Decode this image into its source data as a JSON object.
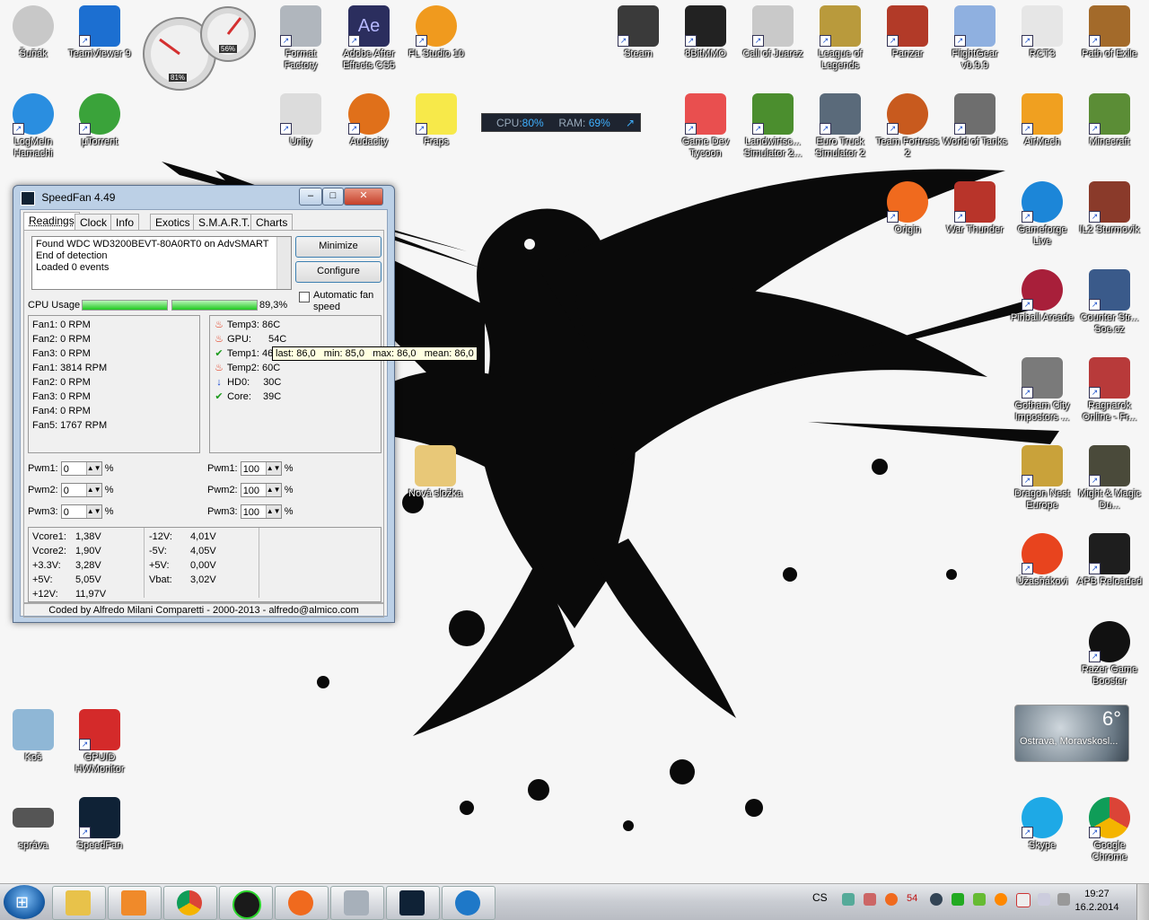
{
  "desktop": {
    "icons_left": [
      {
        "label": "Šuňák",
        "icon": "disk-icon",
        "color": "#c8c8c8"
      },
      {
        "label": "TeamViewer 9",
        "icon": "teamviewer-icon",
        "color": "#1c6fd1"
      },
      {
        "label": "Format Factory",
        "icon": "format-factory-icon",
        "color": "#b0b6bd"
      },
      {
        "label": "Adobe After Effects CS5",
        "icon": "after-effects-icon",
        "color": "#2b2e5e"
      },
      {
        "label": "FL Studio 10",
        "icon": "fl-studio-icon",
        "color": "#f09a1e"
      },
      {
        "label": "LogMeIn Hamachi",
        "icon": "hamachi-icon",
        "color": "#2a8ee0"
      },
      {
        "label": "µTorrent",
        "icon": "utorrent-icon",
        "color": "#3aa33a"
      },
      {
        "label": "Unity",
        "icon": "unity-icon",
        "color": "#dcdcdc"
      },
      {
        "label": "Audacity",
        "icon": "audacity-icon",
        "color": "#e0701a"
      },
      {
        "label": "Fraps",
        "icon": "fraps-icon",
        "color": "#f7e94a"
      },
      {
        "label": "Koš",
        "icon": "recycle-bin-icon",
        "color": "#8fb7d6"
      },
      {
        "label": "GPUID HWMonitor",
        "icon": "hwmonitor-icon",
        "color": "#d42a2a"
      },
      {
        "label": "správa",
        "icon": "chip-icon",
        "color": "#555555"
      },
      {
        "label": "SpeedFan",
        "icon": "speedfan-icon",
        "color": "#0f2236"
      }
    ],
    "icons_right": [
      {
        "label": "Steam",
        "icon": "steam-icon",
        "color": "#3a3a3a"
      },
      {
        "label": "8BitMMO",
        "icon": "8bitmmo-icon",
        "color": "#222222"
      },
      {
        "label": "Call of Juarez",
        "icon": "call-of-juarez-icon",
        "color": "#c9c9c9"
      },
      {
        "label": "League of Legends",
        "icon": "lol-icon",
        "color": "#b99a3c"
      },
      {
        "label": "Panzar",
        "icon": "panzar-icon",
        "color": "#b23a28"
      },
      {
        "label": "FlightGear v0.9.9",
        "icon": "flightgear-icon",
        "color": "#8fb0e0"
      },
      {
        "label": "RCT3",
        "icon": "rct3-icon",
        "color": "#e6e6e6"
      },
      {
        "label": "Path of Exile",
        "icon": "poe-icon",
        "color": "#a36a2a"
      },
      {
        "label": "Game Dev Tycoon",
        "icon": "game-dev-tycoon-icon",
        "color": "#e94f4f"
      },
      {
        "label": "Landwirtsc... Simulator 2...",
        "icon": "farming-sim-icon",
        "color": "#4b8e2e"
      },
      {
        "label": "Euro Truck Simulator 2",
        "icon": "ets2-icon",
        "color": "#5a6a7a"
      },
      {
        "label": "Team Fortress 2",
        "icon": "tf2-icon",
        "color": "#c85a1e"
      },
      {
        "label": "World of Tanks",
        "icon": "wot-icon",
        "color": "#6e6e6e"
      },
      {
        "label": "AirMech",
        "icon": "airmech-icon",
        "color": "#f0a020"
      },
      {
        "label": "Minecraft",
        "icon": "minecraft-icon",
        "color": "#5b8d36"
      },
      {
        "label": "Origin",
        "icon": "origin-icon",
        "color": "#f06a1e"
      },
      {
        "label": "War Thunder",
        "icon": "war-thunder-icon",
        "color": "#b8342a"
      },
      {
        "label": "Gameforge Live",
        "icon": "gameforge-icon",
        "color": "#1c86d8"
      },
      {
        "label": "IL2 Sturmovik",
        "icon": "il2-icon",
        "color": "#8a3a2a"
      },
      {
        "label": "Pinball Arcade",
        "icon": "pinball-icon",
        "color": "#a81f3a"
      },
      {
        "label": "Counter Str... Soe.cz",
        "icon": "counter-strike-icon",
        "color": "#3a5a8a"
      },
      {
        "label": "Gotham City Impostors ...",
        "icon": "gotham-icon",
        "color": "#7a7a7a"
      },
      {
        "label": "Ragnarok Online - Fr...",
        "icon": "ragnarok-icon",
        "color": "#b83a3a"
      },
      {
        "label": "Dragon Nest Europe",
        "icon": "dragon-nest-icon",
        "color": "#c9a23a"
      },
      {
        "label": "Might & Magic Du...",
        "icon": "might-magic-icon",
        "color": "#4a4a3a"
      },
      {
        "label": "Úžasňákovi",
        "icon": "incredibles-icon",
        "color": "#e8441e"
      },
      {
        "label": "APB Reloaded",
        "icon": "apb-icon",
        "color": "#1e1e1e"
      },
      {
        "label": "Razer Game Booster",
        "icon": "razer-icon",
        "color": "#111111"
      },
      {
        "label": "Skype",
        "icon": "skype-icon",
        "color": "#1ea9e6"
      },
      {
        "label": "Google Chrome",
        "icon": "chrome-icon",
        "color": "#e0b020"
      }
    ],
    "folder": {
      "label": "Nová složka",
      "icon": "folder-icon"
    }
  },
  "gauge_gadget": {
    "cpu": "81%",
    "ram": "56%"
  },
  "cpu_widget": {
    "cpu_label": "CPU:",
    "cpu_value": "80%",
    "ram_label": "RAM:",
    "ram_value": "69%"
  },
  "speedfan": {
    "title": "SpeedFan 4.49",
    "tabs": [
      "Readings",
      "Clock",
      "Info",
      "Exotics",
      "S.M.A.R.T.",
      "Charts"
    ],
    "log": [
      "Found WDC WD3200BEVT-80A0RT0 on AdvSMART",
      "End of detection",
      "Loaded 0 events"
    ],
    "buttons": {
      "minimize": "Minimize",
      "configure": "Configure"
    },
    "auto_fan": "Automatic fan speed",
    "cpu_usage_label": "CPU Usage",
    "cpu_usage_value": "89,3%",
    "cpu_usage_bars": [
      1.0,
      1.0
    ],
    "fans": [
      "Fan1: 0 RPM",
      "Fan2: 0 RPM",
      "Fan3: 0 RPM",
      "Fan1: 3814 RPM",
      "Fan2: 0 RPM",
      "Fan3: 0 RPM",
      "Fan4: 0 RPM",
      "Fan5: 1767 RPM"
    ],
    "temps": [
      {
        "label": "Temp3:",
        "value": "86C",
        "status": "hot"
      },
      {
        "label": "GPU:",
        "value": "54C",
        "status": "hot"
      },
      {
        "label": "Temp1:",
        "value": "46C",
        "status": "ok"
      },
      {
        "label": "Temp2:",
        "value": "60C",
        "status": "hot"
      },
      {
        "label": "HD0:",
        "value": "30C",
        "status": "down"
      },
      {
        "label": "Core:",
        "value": "39C",
        "status": "ok"
      }
    ],
    "tooltip": "last: 86,0   min: 85,0   max: 86,0   mean: 86,0",
    "pwm_left": [
      {
        "label": "Pwm1:",
        "value": "0"
      },
      {
        "label": "Pwm2:",
        "value": "0"
      },
      {
        "label": "Pwm3:",
        "value": "0"
      }
    ],
    "pwm_right": [
      {
        "label": "Pwm1:",
        "value": "100"
      },
      {
        "label": "Pwm2:",
        "value": "100"
      },
      {
        "label": "Pwm3:",
        "value": "100"
      }
    ],
    "pwm_unit": "%",
    "volts_a": [
      {
        "label": "Vcore1:",
        "value": "1,38V"
      },
      {
        "label": "Vcore2:",
        "value": "1,90V"
      },
      {
        "label": "+3.3V:",
        "value": "3,28V"
      },
      {
        "label": "+5V:",
        "value": "5,05V"
      },
      {
        "label": "+12V:",
        "value": "11,97V"
      }
    ],
    "volts_b": [
      {
        "label": "-12V:",
        "value": "4,01V"
      },
      {
        "label": "-5V:",
        "value": "4,05V"
      },
      {
        "label": "+5V:",
        "value": "0,00V"
      },
      {
        "label": "Vbat:",
        "value": "3,02V"
      }
    ],
    "footer": "Coded by Alfredo Milani Comparetti - 2000-2013 - alfredo@almico.com"
  },
  "weather": {
    "temp": "6°",
    "location": "Ostrava, Moravskosl..."
  },
  "taskbar": {
    "apps": [
      {
        "icon": "explorer-icon",
        "color": "#e8c24a"
      },
      {
        "icon": "media-player-icon",
        "color": "#f08a2a"
      },
      {
        "icon": "chrome-icon",
        "color": "#d9412f"
      },
      {
        "icon": "razer-icon",
        "color": "#1a1a1a"
      },
      {
        "icon": "origin-icon",
        "color": "#f06a1e"
      },
      {
        "icon": "format-factory-icon",
        "color": "#a7b0ba"
      },
      {
        "icon": "speedfan-icon",
        "color": "#0f2236"
      },
      {
        "icon": "hamachi-icon",
        "color": "#1e78c8"
      }
    ],
    "lang": "CS",
    "tray_temp": "54",
    "time": "19:27",
    "date": "16.2.2014"
  }
}
